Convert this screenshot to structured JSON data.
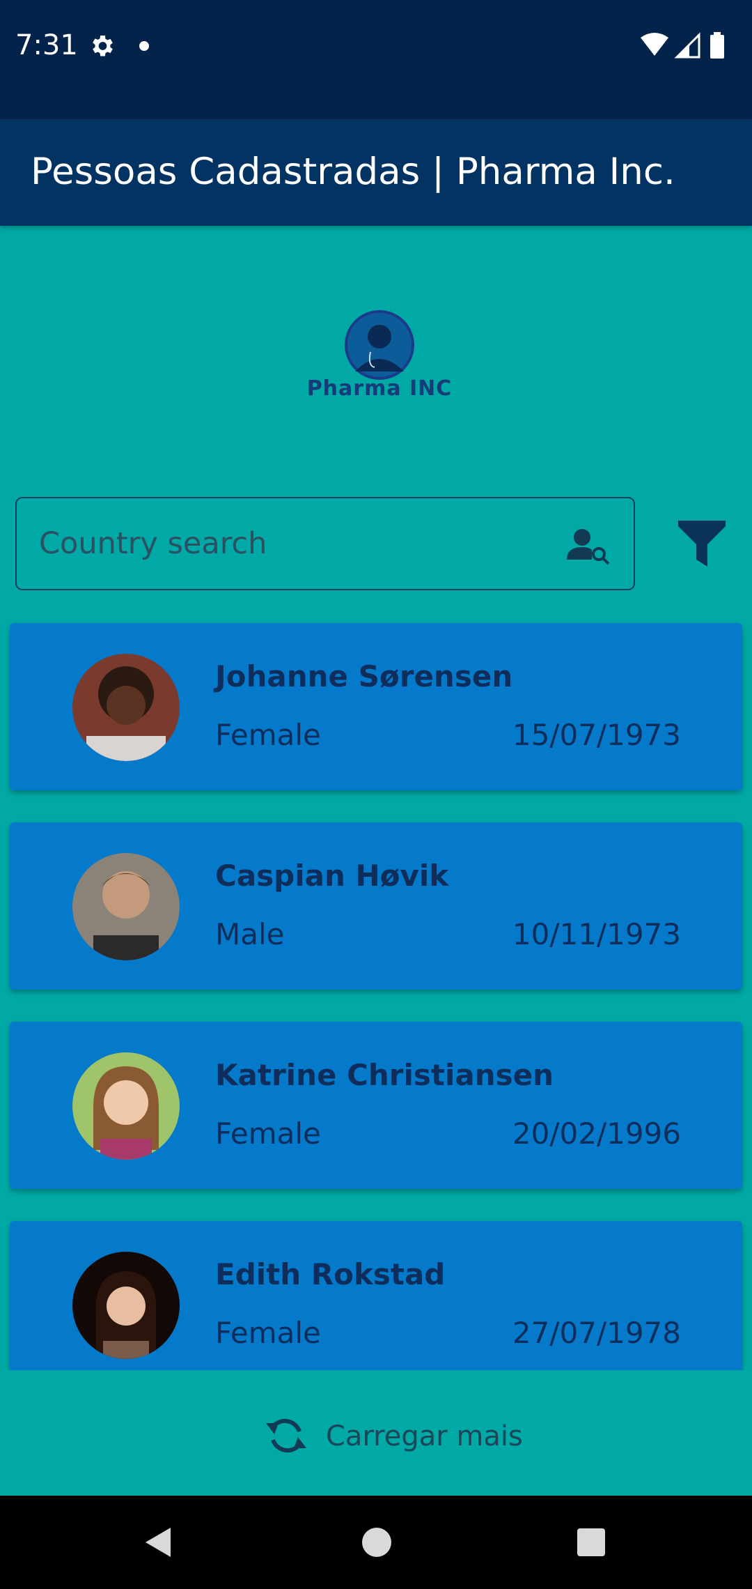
{
  "status_bar": {
    "time": "7:31"
  },
  "app_bar": {
    "title": "Pessoas Cadastradas | Pharma Inc."
  },
  "logo": {
    "text": "Pharma INC"
  },
  "search": {
    "placeholder": "Country search"
  },
  "people": [
    {
      "name": "Johanne Sørensen",
      "gender": "Female",
      "birth_date": "15/07/1973"
    },
    {
      "name": "Caspian Høvik",
      "gender": "Male",
      "birth_date": "10/11/1973"
    },
    {
      "name": "Katrine Christiansen",
      "gender": "Female",
      "birth_date": "20/02/1996"
    },
    {
      "name": "Edith Rokstad",
      "gender": "Female",
      "birth_date": "27/07/1978"
    }
  ],
  "load_more": {
    "label": "Carregar mais"
  },
  "icons": {
    "status": [
      "gear-icon",
      "wifi-icon",
      "signal-icon",
      "battery-icon"
    ],
    "search": "person-search-icon",
    "filter": "filter-icon",
    "load_more": "refresh-icon",
    "nav": [
      "back-icon",
      "home-icon",
      "recents-icon"
    ]
  },
  "colors": {
    "background": "#00a9a5",
    "status_bar": "#03234a",
    "app_bar": "#033363",
    "card": "#057acb",
    "card_text": "#0e2d5a"
  }
}
